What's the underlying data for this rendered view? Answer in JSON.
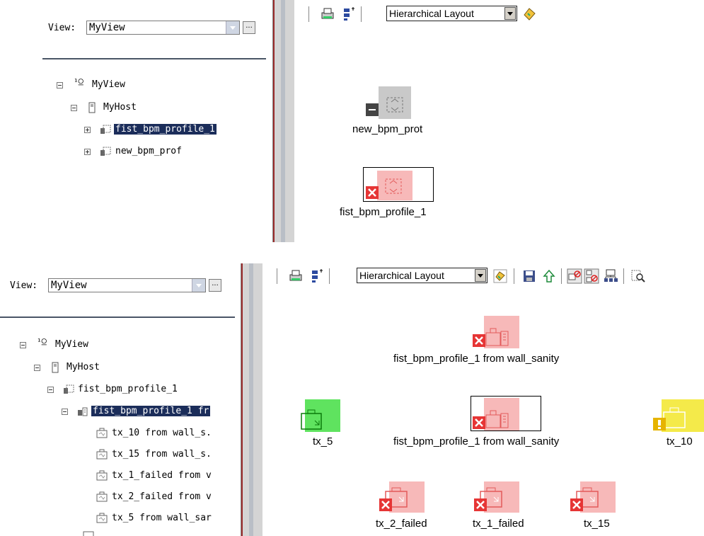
{
  "top": {
    "view_label": "View:",
    "view_value": "MyView",
    "dots": "...",
    "tree": [
      {
        "label": "MyView",
        "icon": "view-icon",
        "expander": "minus"
      },
      {
        "label": "MyHost",
        "icon": "host-icon",
        "expander": "minus"
      },
      {
        "label": "fist_bpm_profile_1",
        "icon": "bpm-profile-icon",
        "expander": "plus",
        "selected": true
      },
      {
        "label": "new_bpm_prof",
        "icon": "bpm-profile-icon",
        "expander": "plus"
      }
    ],
    "toolbar": {
      "layout_value": "Hierarchical Layout"
    },
    "nodes": [
      {
        "label": "new_bpm_prot",
        "status": "unknown",
        "color": "#c9c9c9"
      },
      {
        "label": "fist_bpm_profile_1",
        "status": "critical",
        "color": "#f7b9b9"
      }
    ]
  },
  "bottom": {
    "view_label": "View:",
    "view_value": "MyView",
    "dots": "...",
    "tree": [
      {
        "label": "MyView",
        "icon": "view-icon",
        "expander": "minus"
      },
      {
        "label": "MyHost",
        "icon": "host-icon",
        "expander": "minus"
      },
      {
        "label": "fist_bpm_profile_1",
        "icon": "bpm-profile-icon",
        "expander": "minus"
      },
      {
        "label": "fist_bpm_profile_1 fr",
        "icon": "bpm-app-icon",
        "expander": "minus",
        "selected": true
      },
      {
        "label": "tx_10 from wall_s.",
        "icon": "transaction-icon"
      },
      {
        "label": "tx_15 from wall_s.",
        "icon": "transaction-icon"
      },
      {
        "label": "tx_1_failed from v",
        "icon": "transaction-icon"
      },
      {
        "label": "tx_2_failed from v",
        "icon": "transaction-icon"
      },
      {
        "label": "tx_5 from wall_sar",
        "icon": "transaction-icon"
      }
    ],
    "toolbar": {
      "layout_value": "Hierarchical Layout"
    },
    "nodes": [
      {
        "label": "fist_bpm_profile_1 from wall_sanity",
        "status": "critical",
        "color": "#f7b9b9"
      },
      {
        "label": "tx_5",
        "status": "ok",
        "color": "#5fe35f"
      },
      {
        "label": "fist_bpm_profile_1 from wall_sanity",
        "status": "critical",
        "color": "#f7b9b9"
      },
      {
        "label": "tx_10",
        "status": "warning",
        "color": "#f4ea4a"
      },
      {
        "label": "tx_2_failed",
        "status": "critical",
        "color": "#f7b9b9"
      },
      {
        "label": "tx_1_failed",
        "status": "critical",
        "color": "#f7b9b9"
      },
      {
        "label": "tx_15",
        "status": "critical",
        "color": "#f7b9b9"
      }
    ]
  }
}
